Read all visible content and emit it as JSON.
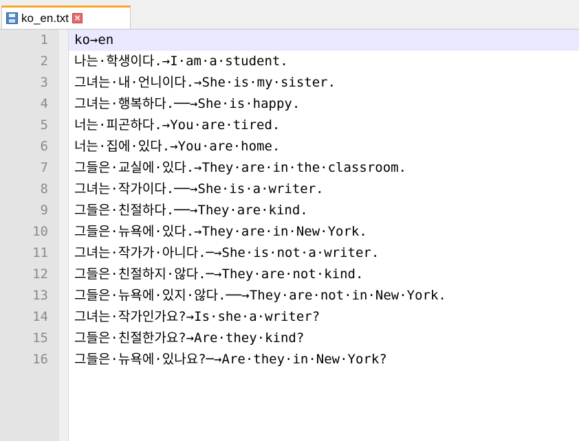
{
  "tab": {
    "filename": "ko_en.txt",
    "save_icon": "floppy-disk-icon",
    "close_icon": "close-icon"
  },
  "colors": {
    "active_tab_accent": "#f6a828",
    "current_line_highlight": "#e8e8ff",
    "gutter": "#e4e4e4"
  },
  "lines": [
    {
      "number": "1",
      "text": "ko→en"
    },
    {
      "number": "2",
      "text": "나는·학생이다.→I·am·a·student."
    },
    {
      "number": "3",
      "text": "그녀는·내·언니이다.→She·is·my·sister."
    },
    {
      "number": "4",
      "text": "그녀는·행복하다.──→She·is·happy."
    },
    {
      "number": "5",
      "text": "너는·피곤하다.→You·are·tired."
    },
    {
      "number": "6",
      "text": "너는·집에·있다.→You·are·home."
    },
    {
      "number": "7",
      "text": "그들은·교실에·있다.→They·are·in·the·classroom."
    },
    {
      "number": "8",
      "text": "그녀는·작가이다.──→She·is·a·writer."
    },
    {
      "number": "9",
      "text": "그들은·친절하다.──→They·are·kind."
    },
    {
      "number": "10",
      "text": "그들은·뉴욕에·있다.→They·are·in·New·York."
    },
    {
      "number": "11",
      "text": "그녀는·작가가·아니다.─→She·is·not·a·writer."
    },
    {
      "number": "12",
      "text": "그들은·친절하지·않다.─→They·are·not·kind."
    },
    {
      "number": "13",
      "text": "그들은·뉴욕에·있지·않다.──→They·are·not·in·New·York."
    },
    {
      "number": "14",
      "text": "그녀는·작가인가요?→Is·she·a·writer?"
    },
    {
      "number": "15",
      "text": "그들은·친절한가요?→Are·they·kind?"
    },
    {
      "number": "16",
      "text": "그들은·뉴욕에·있나요?─→Are·they·in·New·York?"
    }
  ]
}
